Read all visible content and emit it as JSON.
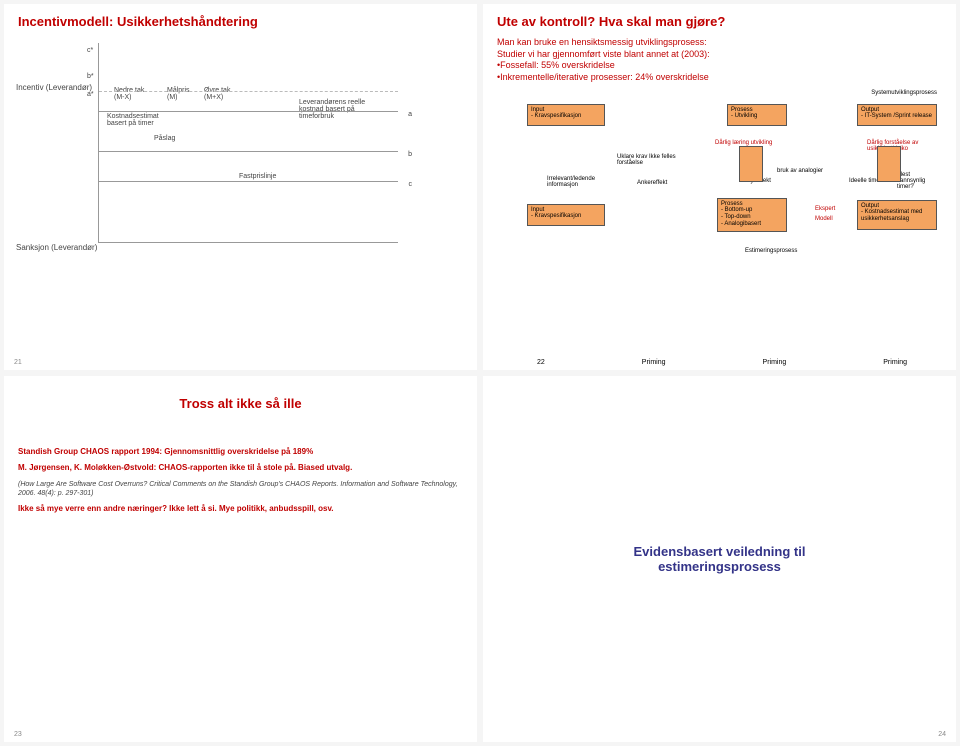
{
  "chart_data": {
    "type": "line",
    "title": "",
    "xlabel": "",
    "ylabel": "Incentiv (Leverandør)",
    "annotations": [
      "c*",
      "b*",
      "a*",
      "a",
      "b",
      "c"
    ],
    "elements": [
      "Nedre tak (M-X)",
      "Målpris (M)",
      "Øvre tak (M+X)",
      "Kostnadsestimat basert på timer",
      "Påslag",
      "Fastprislinje",
      "Sanksjon (Leverandør)",
      "Leverandørens reelle kostnad basert på timeforbruk"
    ]
  },
  "s21": {
    "title": "Incentivmodell: Usikkerhetshåndtering",
    "num": "21",
    "y": "Incentiv (Leverandør)",
    "c1": "c*",
    "b1": "b*",
    "a1": "a*",
    "nedre": "Nedre tak (M-X)",
    "mal": "Målpris (M)",
    "ovre": "Øvre tak (M+X)",
    "kost": "Kostnadsestimat basert på timer",
    "paslag": "Påslag",
    "a2": "a",
    "b2": "b",
    "c2": "c",
    "fast": "Fastprislinje",
    "sank": "Sanksjon (Leverandør)",
    "lev": "Leverandørens reelle kostnad basert på timeforbruk"
  },
  "s22": {
    "title": "Ute av kontroll? Hva skal man gjøre?",
    "intro1": "Man kan bruke en hensiktsmessig utviklingsprosess:",
    "intro2": "Studier vi har gjennomført viste blant annet at (2003):",
    "b1": "•Fossefall: 55% overskridelse",
    "b2": "•Inkrementelle/iterative prosesser: 24% overskridelse",
    "sys": "Systemutviklingsprosess",
    "est": "Estimeringsprosess",
    "input1": "Input",
    "input1b": "- Kravspesifikasjon",
    "pros1": "Prosess",
    "pros1b": "- Utvikling",
    "out1": "Output",
    "out1b": "- IT-System /Sprint release",
    "darlig1": "Dårlig læring utvikling",
    "darlig2": "Dårlig forståelse av usikkehet/risiko",
    "uklare": "Uklare krav Ikke felles forståelse",
    "irr": "Irrelevant/ledende informasjon",
    "anker": "Ankereffekt",
    "fyll": "Fylleffekt",
    "bruk": "bruk av analogier",
    "ideelle": "Ideelle timer?",
    "mest": "Mest sannsynlig timer?",
    "input2": "Input",
    "input2b": "- Kravspesifikasjon",
    "pros2": "Prosess",
    "pros2b1": "- Bottom-up",
    "pros2b2": "- Top-down",
    "pros2b3": "- Analogibasert",
    "eksp": "Ekspert",
    "model": "Modell",
    "out2": "Output",
    "out2b": "- Kostnadsestimat med usikkerhetsanslag",
    "prim": "Priming",
    "num": "22"
  },
  "s23": {
    "title": "Tross alt ikke så ille",
    "l1": "Standish Group CHAOS rapport 1994: Gjennomsnittlig overskridelse på 189%",
    "l2": "M. Jørgensen, K. Moløkken-Østvold: CHAOS-rapporten ikke til å stole på. Biased utvalg.",
    "l3": "(How Large Are Software Cost Overruns? Critical Comments on the Standish Group's CHAOS Reports. Information and Software Technology, 2006. 48(4): p. 297-301)",
    "l4": "Ikke så mye verre enn andre næringer? Ikke lett å si. Mye politikk, anbudsspill, osv.",
    "num": "23"
  },
  "s24": {
    "t1": "Evidensbasert veiledning til",
    "t2": "estimeringsprosess",
    "num": "24"
  }
}
